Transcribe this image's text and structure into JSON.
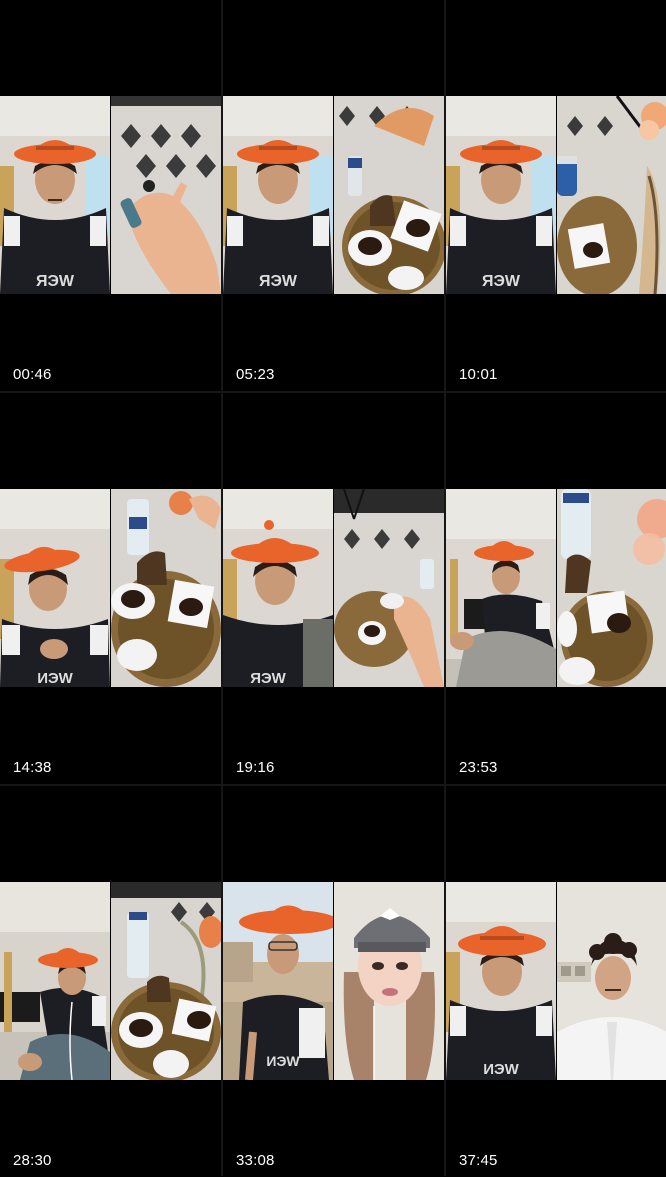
{
  "grid": {
    "items": [
      {
        "time": "00:46",
        "left": "person-with-orange-hat",
        "right": "hand-over-rug"
      },
      {
        "time": "05:23",
        "left": "person-with-orange-hat",
        "right": "coffee-tray"
      },
      {
        "time": "10:01",
        "left": "person-with-orange-hat",
        "right": "coffee-tray-flowers"
      },
      {
        "time": "14:38",
        "left": "person-with-orange-hat",
        "right": "coffee-tray"
      },
      {
        "time": "19:16",
        "left": "person-with-orange-hat",
        "right": "hand-holding-cup"
      },
      {
        "time": "23:53",
        "left": "person-sitting-wide",
        "right": "coffee-tray-flowers"
      },
      {
        "time": "28:30",
        "left": "person-sitting-room",
        "right": "coffee-tray"
      },
      {
        "time": "33:08",
        "left": "person-outdoors",
        "right": "woman-with-cap"
      },
      {
        "time": "37:45",
        "left": "person-with-orange-hat",
        "right": "man-in-white-thobe"
      }
    ]
  },
  "colors": {
    "background": "#000000",
    "hat": "#e8642a",
    "jersey": "#1b1b22",
    "wall": "#d9d6d0",
    "tray": "#8a6a3a"
  }
}
